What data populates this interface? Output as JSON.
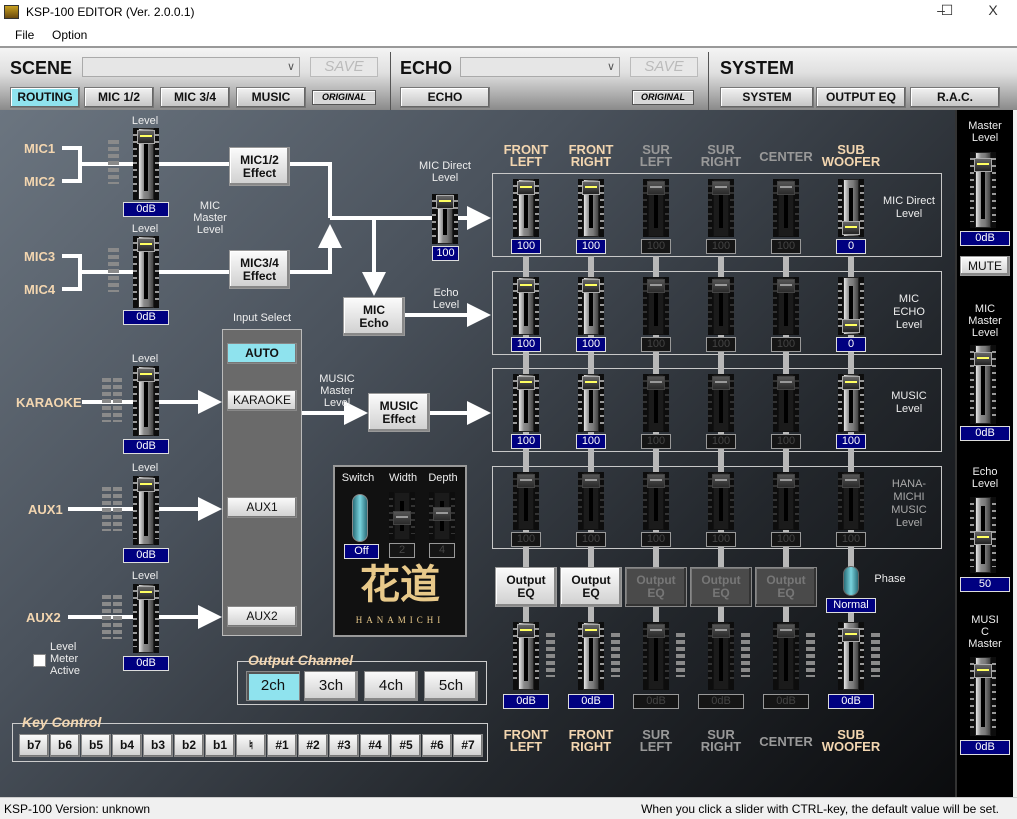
{
  "window": {
    "title": "KSP-100 EDITOR (Ver. 2.0.0.1)",
    "minimize": "–",
    "maximize": "☐",
    "close": "X"
  },
  "menu": [
    "File",
    "Option"
  ],
  "scene": {
    "label": "SCENE",
    "select_value": "",
    "save": "SAVE",
    "tabs": [
      "ROUTING",
      "MIC 1/2",
      "MIC 3/4",
      "MUSIC"
    ],
    "active_tab": "ROUTING",
    "original": "ORIGINAL"
  },
  "echo": {
    "label": "ECHO",
    "select_value": "",
    "save": "SAVE",
    "tab": "ECHO",
    "original": "ORIGINAL"
  },
  "system": {
    "label": "SYSTEM",
    "tabs": [
      "SYSTEM",
      "OUTPUT EQ",
      "R.A.C."
    ]
  },
  "inputs": {
    "mic1": "MIC1",
    "mic2": "MIC2",
    "mic3": "MIC3",
    "mic4": "MIC4",
    "karaoke": "KARAOKE",
    "aux1": "AUX1",
    "aux2": "AUX2",
    "level_label": "Level",
    "mic12": {
      "value": "0dB",
      "level": 0.96
    },
    "mic34": {
      "value": "0dB",
      "level": 0.96
    },
    "karaoke_level": {
      "value": "0dB",
      "level": 0.96
    },
    "aux1_level": {
      "value": "0dB",
      "level": 0.96
    },
    "aux2_level": {
      "value": "0dB",
      "level": 0.96
    }
  },
  "effects": {
    "mic12": "MIC1/2\nEffect",
    "mic34": "MIC3/4\nEffect",
    "mic_echo": "MIC\nEcho",
    "music": "MUSIC\nEffect"
  },
  "labels": {
    "mic_master": "MIC\nMaster\nLevel",
    "mic_direct": "MIC Direct\nLevel",
    "echo_level": "Echo\nLevel",
    "music_master": "MUSIC\nMaster\nLevel",
    "input_select": "Input Select",
    "level_meter_active": "Level\nMeter\nActive"
  },
  "mic_direct": {
    "value": "100",
    "level": 0.96
  },
  "level_meter_active": false,
  "input_select": {
    "options": [
      "AUTO",
      "KARAOKE",
      "AUX1",
      "AUX2"
    ],
    "selected": "AUTO"
  },
  "hanamichi": {
    "switch_label": "Switch",
    "width_label": "Width",
    "depth_label": "Depth",
    "switch_value": "Off",
    "width_value": "2",
    "depth_value": "4",
    "width_level": 0.45,
    "depth_level": 0.55,
    "logo": "花道",
    "logo_sub": "HANAMICHI"
  },
  "output_channel": {
    "title": "Output Channel",
    "options": [
      "2ch",
      "3ch",
      "4ch",
      "5ch"
    ],
    "selected": "2ch"
  },
  "key_control": {
    "title": "Key Control",
    "keys": [
      "b7",
      "b6",
      "b5",
      "b4",
      "b3",
      "b2",
      "b1",
      "♮",
      "#1",
      "#2",
      "#3",
      "#4",
      "#5",
      "#6",
      "#7"
    ]
  },
  "outputs": {
    "channels": [
      {
        "name": "FRONT\nLEFT",
        "active": true,
        "eq": "Output\nEQ",
        "value": "0dB",
        "level": 0.96
      },
      {
        "name": "FRONT\nRIGHT",
        "active": true,
        "eq": "Output\nEQ",
        "value": "0dB",
        "level": 0.96
      },
      {
        "name": "SUR\nLEFT",
        "active": false,
        "eq": "Output\nEQ",
        "value": "0dB",
        "level": 0.96
      },
      {
        "name": "SUR\nRIGHT",
        "active": false,
        "eq": "Output\nEQ",
        "value": "0dB",
        "level": 0.96
      },
      {
        "name": "CENTER",
        "active": false,
        "eq": "Output\nEQ",
        "value": "0dB",
        "level": 0.96
      },
      {
        "name": "SUB\nWOOFER",
        "active": true,
        "eq": "",
        "value": "0dB",
        "level": 0.88
      }
    ],
    "rows": [
      {
        "label": "MIC Direct\nLevel",
        "values": [
          "100",
          "100",
          "100",
          "100",
          "100",
          "0"
        ],
        "levels": [
          0.96,
          0.96,
          0.96,
          0.96,
          0.96,
          0.04
        ],
        "active": [
          true,
          true,
          false,
          false,
          false,
          true
        ]
      },
      {
        "label": "MIC\nECHO\nLevel",
        "values": [
          "100",
          "100",
          "100",
          "100",
          "100",
          "0"
        ],
        "levels": [
          0.96,
          0.96,
          0.96,
          0.96,
          0.96,
          0.04
        ],
        "active": [
          true,
          true,
          false,
          false,
          false,
          true
        ]
      },
      {
        "label": "MUSIC\nLevel",
        "values": [
          "100",
          "100",
          "100",
          "100",
          "100",
          "100"
        ],
        "levels": [
          0.96,
          0.96,
          0.96,
          0.96,
          0.96,
          0.96
        ],
        "active": [
          true,
          true,
          false,
          false,
          false,
          true
        ]
      },
      {
        "label": "HANA-\nMICHI\nMUSIC\nLevel",
        "values": [
          "100",
          "100",
          "100",
          "100",
          "100",
          "100"
        ],
        "levels": [
          0.96,
          0.96,
          0.96,
          0.96,
          0.96,
          0.96
        ],
        "active": [
          false,
          false,
          false,
          false,
          false,
          false
        ]
      }
    ],
    "phase_label": "Phase",
    "phase_value": "Normal"
  },
  "right_panel": {
    "master": {
      "label": "Master\nLevel",
      "value": "0dB",
      "level": 0.9
    },
    "mute": "MUTE",
    "mic_master": {
      "label": "MIC\nMaster\nLevel",
      "value": "0dB",
      "level": 0.9
    },
    "echo_level": {
      "label": "Echo\nLevel",
      "value": "50",
      "level": 0.45
    },
    "music_master": {
      "label": "MUSI\nC\nMaster",
      "value": "0dB",
      "level": 0.9
    }
  },
  "status": {
    "left": "KSP-100 Version: unknown",
    "right": "When you click a slider with CTRL-key, the default value will be set."
  },
  "colors": {
    "active_label": "#f3d6b0",
    "selected_button": "#8fe3ee",
    "value_box": "#000080"
  }
}
